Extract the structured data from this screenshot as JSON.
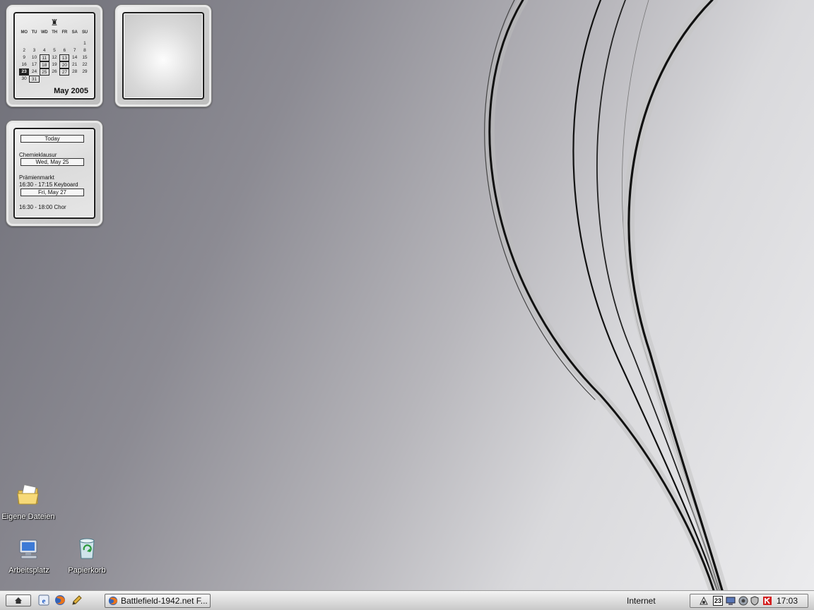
{
  "calendar": {
    "weekdays": [
      "MO",
      "TU",
      "WD",
      "TH",
      "FR",
      "SA",
      "SU"
    ],
    "weeks": [
      [
        {
          "d": ""
        },
        {
          "d": ""
        },
        {
          "d": ""
        },
        {
          "d": ""
        },
        {
          "d": ""
        },
        {
          "d": ""
        },
        {
          "d": "1"
        }
      ],
      [
        {
          "d": "2"
        },
        {
          "d": "3"
        },
        {
          "d": "4"
        },
        {
          "d": "5"
        },
        {
          "d": "6"
        },
        {
          "d": "7"
        },
        {
          "d": "8"
        }
      ],
      [
        {
          "d": "9"
        },
        {
          "d": "10"
        },
        {
          "d": "11",
          "boxed": true
        },
        {
          "d": "12"
        },
        {
          "d": "13",
          "boxed": true
        },
        {
          "d": "14"
        },
        {
          "d": "15"
        }
      ],
      [
        {
          "d": "16"
        },
        {
          "d": "17"
        },
        {
          "d": "18",
          "boxed": true
        },
        {
          "d": "19"
        },
        {
          "d": "20",
          "boxed": true
        },
        {
          "d": "21"
        },
        {
          "d": "22"
        }
      ],
      [
        {
          "d": "23",
          "today": true
        },
        {
          "d": "24"
        },
        {
          "d": "25",
          "boxed": true
        },
        {
          "d": "26"
        },
        {
          "d": "27",
          "boxed": true
        },
        {
          "d": "28"
        },
        {
          "d": "29"
        }
      ],
      [
        {
          "d": "30"
        },
        {
          "d": "31",
          "boxed": true
        },
        {
          "d": ""
        },
        {
          "d": ""
        },
        {
          "d": ""
        },
        {
          "d": ""
        },
        {
          "d": ""
        }
      ]
    ],
    "month_label": "May 2005"
  },
  "agenda": {
    "today_label": "Today",
    "event1": "Chemieklausur",
    "date1": "Wed, May 25",
    "event2": "Prämienmarkt",
    "event3": "16:30 - 17:15 Keyboard",
    "date2": "Fri, May 27",
    "event4": "16:30 - 18:00 Chor"
  },
  "desktop_icons": {
    "documents": "Eigene Dateien",
    "computer": "Arbeitsplatz",
    "recycle": "Papierkorb"
  },
  "taskbar": {
    "start_icon": "home-icon",
    "quicklaunch": [
      "ie-icon",
      "firefox-icon",
      "pencil-icon"
    ],
    "task_label": "Battlefield-1942.net F...",
    "address_zone": "Internet",
    "tray_date": "23",
    "clock": "17:03"
  }
}
